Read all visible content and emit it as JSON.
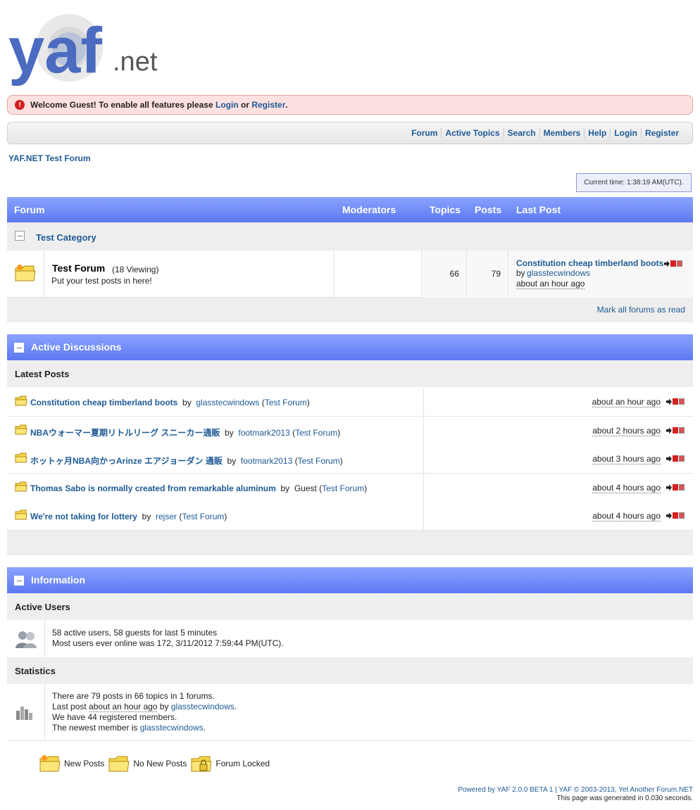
{
  "logo": {
    "main": "yaf",
    "suffix": ".net"
  },
  "welcome": {
    "prefix": "Welcome Guest! To enable all features please",
    "login": "Login",
    "or": "or",
    "register": "Register",
    "suffix": "."
  },
  "menu": [
    "Forum",
    "Active Topics",
    "Search",
    "Members",
    "Help",
    "Login",
    "Register"
  ],
  "breadcrumb": "YAF.NET Test Forum",
  "current_time": "Current time: 1:38:19 AM(UTC).",
  "forum_table": {
    "headers": {
      "forum": "Forum",
      "moderators": "Moderators",
      "topics": "Topics",
      "posts": "Posts",
      "last_post": "Last Post"
    },
    "category": "Test Category",
    "forum": {
      "name": "Test Forum",
      "viewing": "(18 Viewing)",
      "description": "Put your test posts in here!",
      "topics": "66",
      "posts": "79",
      "last_post_title": "Constitution cheap timberland boots",
      "last_post_by": "by",
      "last_post_user": "glasstecwindows",
      "last_post_time": "about an hour ago"
    },
    "mark_all": "Mark all forums as read"
  },
  "active_discussions": {
    "title": "Active Discussions",
    "subheader": "Latest Posts",
    "posts": [
      {
        "title": "Constitution cheap timberland boots",
        "by": "by",
        "user": "glasstecwindows",
        "forum": "Test Forum",
        "time": "about an hour ago"
      },
      {
        "title": "NBAウォーマー夏期リトルリーグ スニーカー通販",
        "by": "by",
        "user": "footmark2013",
        "forum": "Test Forum",
        "time": "about 2 hours ago"
      },
      {
        "title": "ホットヶ月NBA向かっArinze エアジョーダン 通販",
        "by": "by",
        "user": "footmark2013",
        "forum": "Test Forum",
        "time": "about 3 hours ago"
      },
      {
        "title": "Thomas Sabo is normally created from remarkable aluminum",
        "by": "by",
        "user": "Guest",
        "forum": "Test Forum",
        "time": "about 4 hours ago"
      },
      {
        "title": "We're not taking for lottery",
        "by": "by",
        "user": "rejser",
        "forum": "Test Forum",
        "time": "about 4 hours ago"
      }
    ]
  },
  "information": {
    "title": "Information",
    "active_users_header": "Active Users",
    "active_users_line1": "58 active users, 58 guests for last 5 minutes",
    "active_users_line2": "Most users ever online was 172, 3/11/2012 7:59:44 PM(UTC).",
    "statistics_header": "Statistics",
    "stats_line1": "There are 79 posts in 66 topics in 1 forums.",
    "stats_line2_prefix": "Last post",
    "stats_line2_time": "about an hour ago",
    "stats_line2_by": "by",
    "stats_line2_user": "glasstecwindows",
    "stats_line2_suffix": ".",
    "stats_line3": "We have 44 registered members.",
    "stats_line4_prefix": "The newest member is",
    "stats_line4_user": "glasstecwindows",
    "stats_line4_suffix": "."
  },
  "legend": {
    "new_posts": "New Posts",
    "no_new_posts": "No New Posts",
    "forum_locked": "Forum Locked"
  },
  "footer": {
    "line1": "Powered by YAF 2.0.0 BETA 1 | YAF © 2003-2013, Yet Another Forum.NET",
    "line2": "This page was generated in 0.030 seconds."
  },
  "colors": {
    "header_blue": "#6f8cf7",
    "link": "#1e5a96",
    "welcome_bg": "#fde0e0"
  }
}
